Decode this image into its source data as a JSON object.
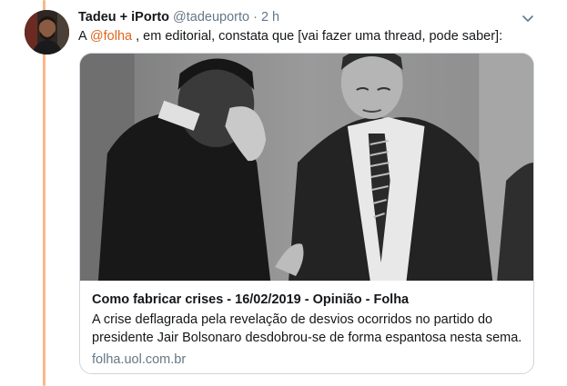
{
  "tweet": {
    "author_name": "Tadeu + iPorto",
    "handle": "@tadeuporto",
    "separator": "·",
    "time": "2 h",
    "text_before": "A ",
    "mention": "@folha",
    "text_after": " , em editorial, constata que [vai fazer uma thread, pode saber]:"
  },
  "card": {
    "title": "Como fabricar crises - 16/02/2019 - Opinião - Folha",
    "description_line1": "A crise deflagrada pela revelação de desvios ocorridos no partido do",
    "description_line2": "presidente Jair Bolsonaro desdobrou-se de forma espantosa nesta sema...",
    "domain": "folha.uol.com.br"
  },
  "icons": {
    "caret": "chevron-down-icon",
    "avatar": "avatar"
  },
  "colors": {
    "mention": "#e0651f",
    "thread_line": "#fbb68a",
    "secondary_text": "#657786",
    "card_border": "#ccd6dd"
  }
}
